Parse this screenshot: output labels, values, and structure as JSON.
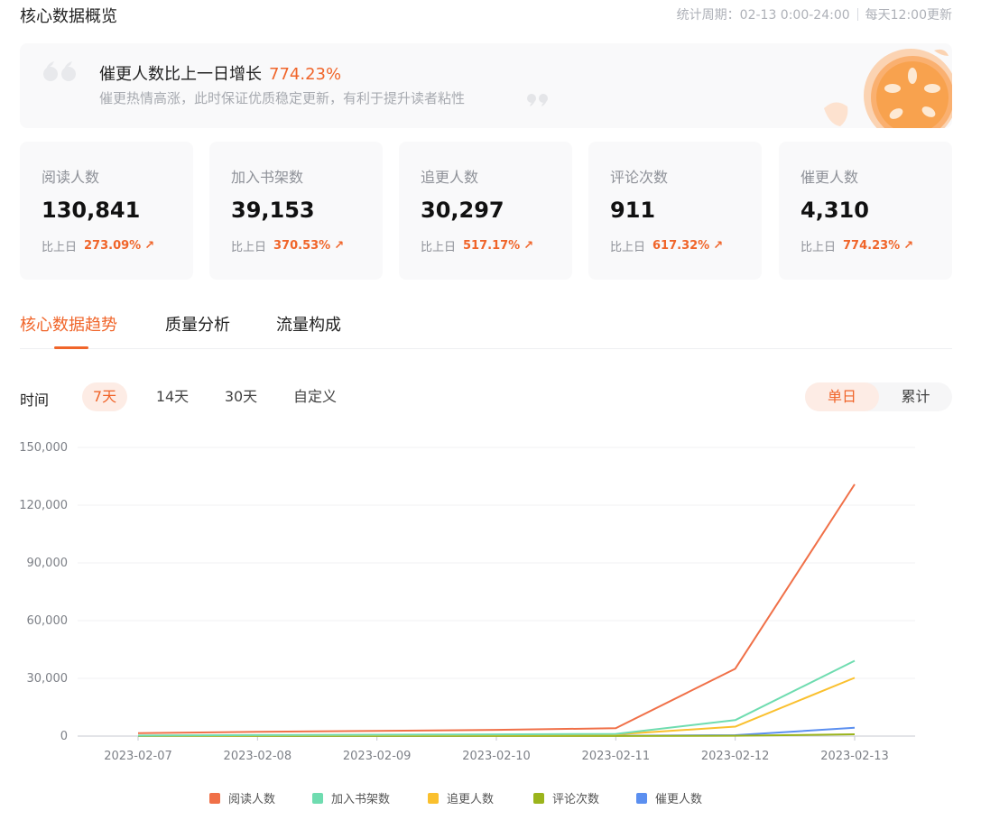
{
  "header": {
    "title": "核心数据概览",
    "period": "统计周期：02-13 0:00-24:00",
    "update_note": "每天12:00更新"
  },
  "banner": {
    "title": "催更人数比上一日增长",
    "percent": "774.23%",
    "subtitle": "催更热情高涨，此时保证优质稳定更新，有利于提升读者粘性"
  },
  "metrics": [
    {
      "label": "阅读人数",
      "value": "130,841",
      "compare_label": "比上日",
      "change": "273.09%"
    },
    {
      "label": "加入书架数",
      "value": "39,153",
      "compare_label": "比上日",
      "change": "370.53%"
    },
    {
      "label": "追更人数",
      "value": "30,297",
      "compare_label": "比上日",
      "change": "517.17%"
    },
    {
      "label": "评论次数",
      "value": "911",
      "compare_label": "比上日",
      "change": "617.32%"
    },
    {
      "label": "催更人数",
      "value": "4,310",
      "compare_label": "比上日",
      "change": "774.23%"
    }
  ],
  "tabs": [
    {
      "label": "核心数据趋势",
      "active": true
    },
    {
      "label": "质量分析",
      "active": false
    },
    {
      "label": "流量构成",
      "active": false
    }
  ],
  "filters": {
    "time_label": "时间",
    "ranges": [
      {
        "label": "7天",
        "active": true
      },
      {
        "label": "14天",
        "active": false
      },
      {
        "label": "30天",
        "active": false
      },
      {
        "label": "自定义",
        "active": false
      }
    ],
    "modes": [
      {
        "label": "单日",
        "active": true
      },
      {
        "label": "累计",
        "active": false
      }
    ]
  },
  "colors": {
    "accent": "#f0652a",
    "accent_light": "#fdece5"
  },
  "icons": {
    "quote_open": "quote-open-icon",
    "quote_close": "quote-close-icon",
    "trend_up": "arrow-up-icon",
    "decoration": "orange-slice-illustration"
  },
  "chart_data": {
    "type": "line",
    "x": [
      "2023-02-07",
      "2023-02-08",
      "2023-02-09",
      "2023-02-10",
      "2023-02-11",
      "2023-02-12",
      "2023-02-13"
    ],
    "ylim": [
      0,
      150000
    ],
    "yticks": [
      0,
      30000,
      60000,
      90000,
      120000,
      150000
    ],
    "ytick_labels": [
      "0",
      "30,000",
      "60,000",
      "90,000",
      "120,000",
      "150,000"
    ],
    "grid": true,
    "legend_position": "bottom",
    "series": [
      {
        "name": "阅读人数",
        "color": "#f07048",
        "values": [
          1500,
          2200,
          2700,
          3200,
          4100,
          35000,
          130841
        ]
      },
      {
        "name": "加入书架数",
        "color": "#6fdcb0",
        "values": [
          300,
          500,
          700,
          900,
          1100,
          8300,
          39153
        ]
      },
      {
        "name": "追更人数",
        "color": "#fac02e",
        "values": [
          250,
          400,
          550,
          700,
          900,
          4900,
          30297
        ]
      },
      {
        "name": "评论次数",
        "color": "#9bb41c",
        "values": [
          30,
          40,
          50,
          60,
          70,
          150,
          911
        ]
      },
      {
        "name": "催更人数",
        "color": "#5b8ff0",
        "values": [
          80,
          100,
          120,
          150,
          180,
          490,
          4310
        ]
      }
    ]
  }
}
